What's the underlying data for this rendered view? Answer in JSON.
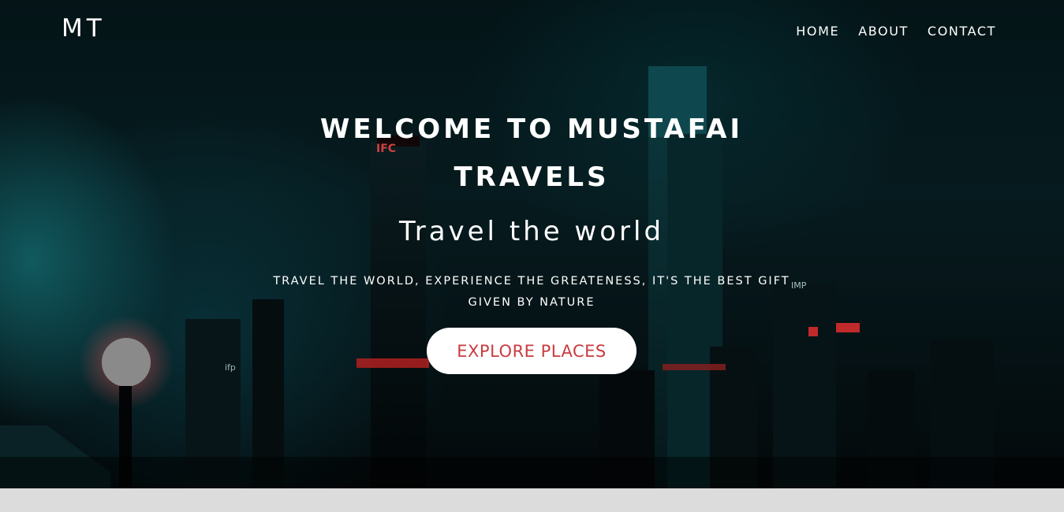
{
  "brand": {
    "logo_text": "MT"
  },
  "nav": {
    "items": [
      "HOME",
      "ABOUT",
      "CONTACT"
    ]
  },
  "hero": {
    "title": "WELCOME TO MUSTAFAI TRAVELS",
    "subtitle": "Travel the world",
    "tagline": "TRAVEL THE WORLD, EXPERIENCE THE GREATENESS, IT'S THE BEST GIFT GIVEN BY NATURE",
    "cta_label": "EXPLORE PLACES",
    "background_image": "night-city-skyline",
    "sign_texts": [
      "IFC",
      "IMP",
      "ifp"
    ]
  },
  "colors": {
    "cta_text": "#c83c40",
    "cta_bg": "#ffffff",
    "nav_text": "#ffffff",
    "footer_strip": "#dcdcdc"
  }
}
